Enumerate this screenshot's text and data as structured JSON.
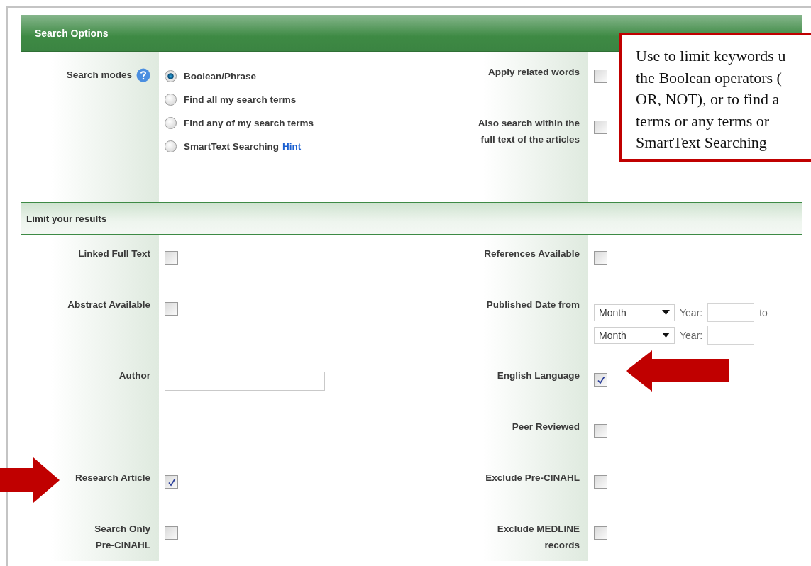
{
  "header": {
    "title": "Search Options"
  },
  "search_modes": {
    "label": "Search modes",
    "options": [
      {
        "label": "Boolean/Phrase",
        "selected": true
      },
      {
        "label": "Find all my search terms",
        "selected": false
      },
      {
        "label": "Find any of my search terms",
        "selected": false
      },
      {
        "label": "SmartText Searching",
        "hint": "Hint",
        "selected": false
      }
    ]
  },
  "related_options": [
    {
      "lines": [
        "Apply related words"
      ],
      "checked": false
    },
    {
      "lines": [
        "Also search within the",
        "full text of the articles"
      ],
      "checked": false
    }
  ],
  "limit_header": {
    "title": "Limit your results"
  },
  "limit_rows": [
    {
      "left": {
        "kind": "checkbox",
        "lines": [
          "Linked Full Text"
        ],
        "checked": false
      },
      "right": {
        "kind": "checkbox",
        "lines": [
          "References Available"
        ],
        "checked": false
      }
    },
    {
      "left": {
        "kind": "checkbox",
        "lines": [
          "Abstract Available"
        ],
        "checked": false
      },
      "right": {
        "kind": "date_range",
        "lines": [
          "Published Date from"
        ],
        "ranges": [
          {
            "month": "Month",
            "year_label": "Year:",
            "suffix": "to"
          },
          {
            "month": "Month",
            "year_label": "Year:"
          }
        ]
      }
    },
    {
      "left": {
        "kind": "text_input",
        "lines": [
          "Author"
        ]
      },
      "right": {
        "kind": "checkbox",
        "lines": [
          "English Language"
        ],
        "checked": true,
        "arrow": {
          "kind": "left_arrow"
        }
      }
    },
    {
      "left": {
        "kind": "empty"
      },
      "right": {
        "kind": "checkbox",
        "lines": [
          "Peer Reviewed"
        ],
        "checked": false
      }
    },
    {
      "left": {
        "kind": "checkbox",
        "lines": [
          "Research Article"
        ],
        "checked": true,
        "arrow": {
          "kind": "right_arrow"
        }
      },
      "right": {
        "kind": "checkbox",
        "lines": [
          "Exclude Pre-CINAHL"
        ],
        "checked": false
      }
    },
    {
      "left": {
        "kind": "checkbox",
        "lines": [
          "Search Only",
          "Pre-CINAHL"
        ],
        "checked": false
      },
      "right": {
        "kind": "checkbox",
        "lines": [
          "Exclude MEDLINE",
          "records"
        ],
        "checked": false
      }
    }
  ],
  "callout": {
    "lines": [
      "Use to limit keywords u",
      "the Boolean operators (",
      "OR, NOT), or to find a",
      "terms or any terms or",
      "SmartText Searching"
    ]
  }
}
